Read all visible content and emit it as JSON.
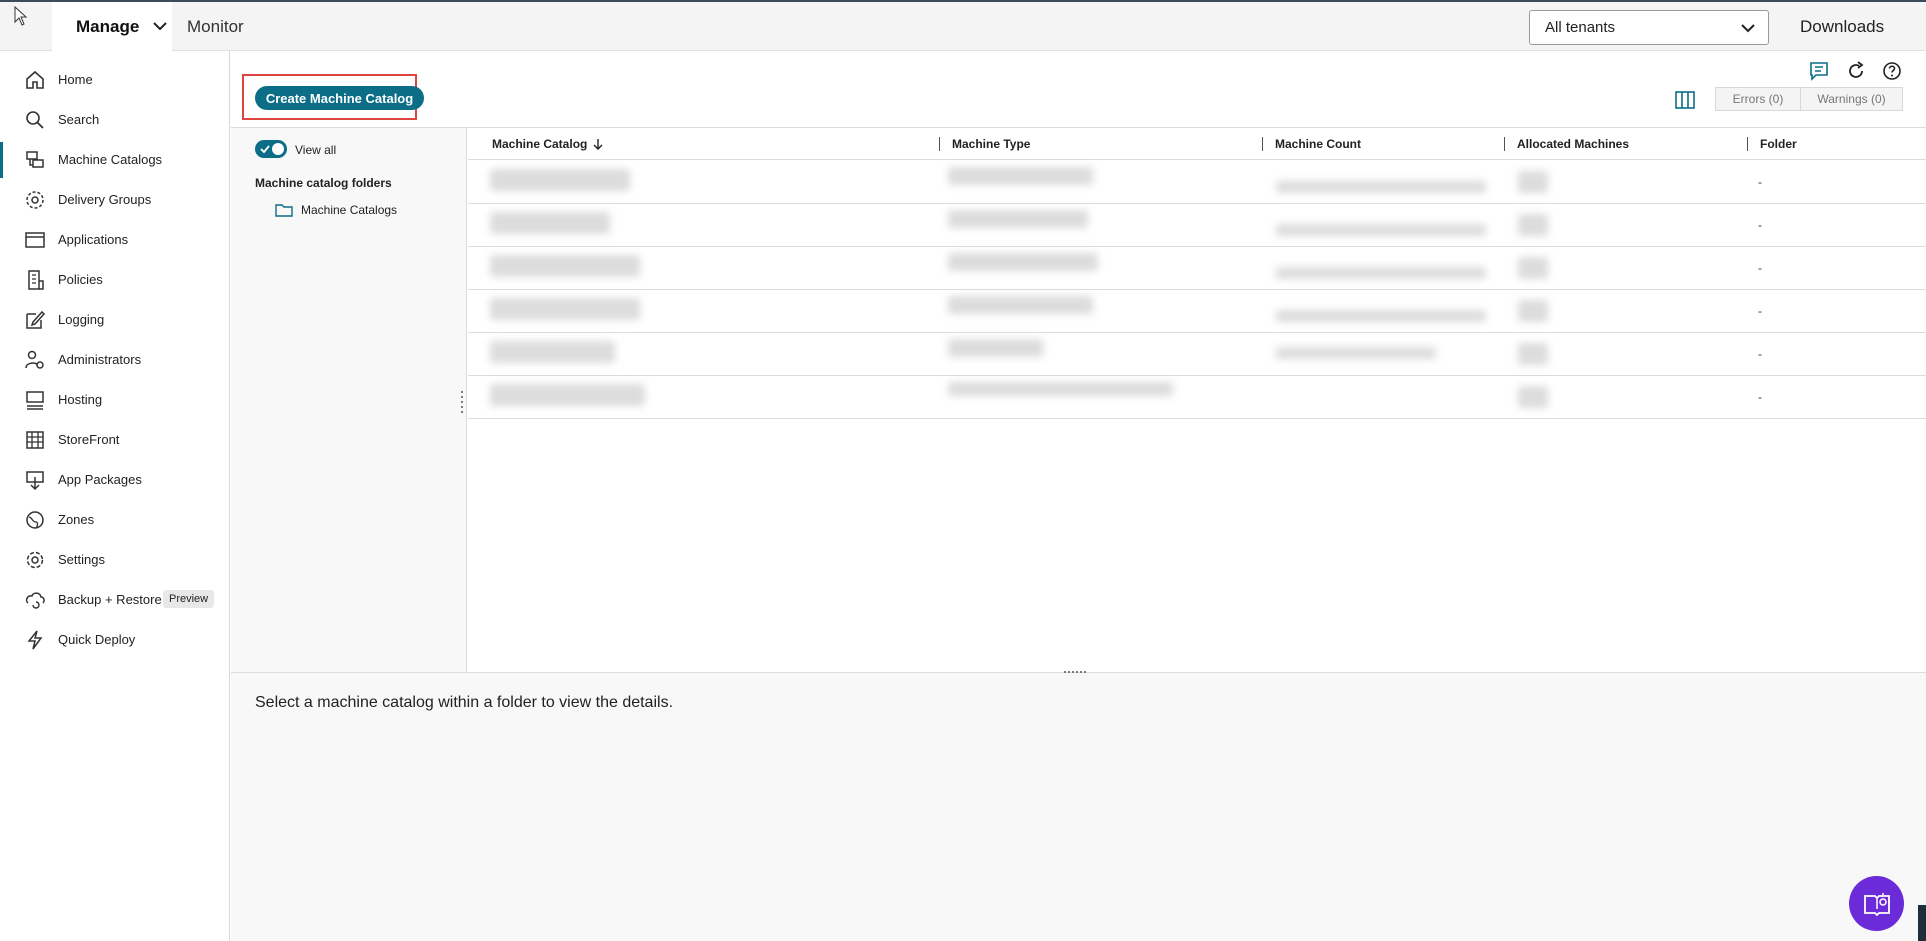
{
  "topbar": {
    "manage_label": "Manage",
    "monitor_label": "Monitor",
    "tenant_select_value": "All tenants",
    "downloads_label": "Downloads"
  },
  "sidebar": {
    "items": [
      {
        "label": "Home",
        "icon": "home-icon"
      },
      {
        "label": "Search",
        "icon": "search-icon"
      },
      {
        "label": "Machine Catalogs",
        "icon": "machine-catalogs-icon",
        "active": true
      },
      {
        "label": "Delivery Groups",
        "icon": "delivery-groups-icon"
      },
      {
        "label": "Applications",
        "icon": "applications-icon"
      },
      {
        "label": "Policies",
        "icon": "policies-icon"
      },
      {
        "label": "Logging",
        "icon": "logging-icon"
      },
      {
        "label": "Administrators",
        "icon": "administrators-icon"
      },
      {
        "label": "Hosting",
        "icon": "hosting-icon"
      },
      {
        "label": "StoreFront",
        "icon": "storefront-icon"
      },
      {
        "label": "App Packages",
        "icon": "app-packages-icon"
      },
      {
        "label": "Zones",
        "icon": "zones-icon"
      },
      {
        "label": "Settings",
        "icon": "settings-icon"
      },
      {
        "label": "Backup + Restore",
        "icon": "backup-restore-icon",
        "badge": "Preview"
      },
      {
        "label": "Quick Deploy",
        "icon": "quick-deploy-icon"
      }
    ]
  },
  "toolbar": {
    "create_label": "Create Machine Catalog",
    "errors_label": "Errors (0)",
    "warnings_label": "Warnings (0)"
  },
  "folders": {
    "view_all_label": "View all",
    "title": "Machine catalog folders",
    "items": [
      "Machine Catalogs"
    ]
  },
  "table": {
    "columns": [
      "Machine Catalog",
      "Machine Type",
      "Machine Count",
      "Allocated Machines",
      "Folder"
    ],
    "rows": [
      {
        "folder": "-"
      },
      {
        "folder": "-"
      },
      {
        "folder": "-"
      },
      {
        "folder": "-"
      },
      {
        "folder": "-"
      },
      {
        "folder": "-"
      }
    ]
  },
  "details": {
    "empty_text": "Select a machine catalog within a folder to view the details."
  },
  "colors": {
    "accent": "#0b6e86",
    "highlight_frame": "#e0443e",
    "help_button": "#6c2bd9"
  }
}
